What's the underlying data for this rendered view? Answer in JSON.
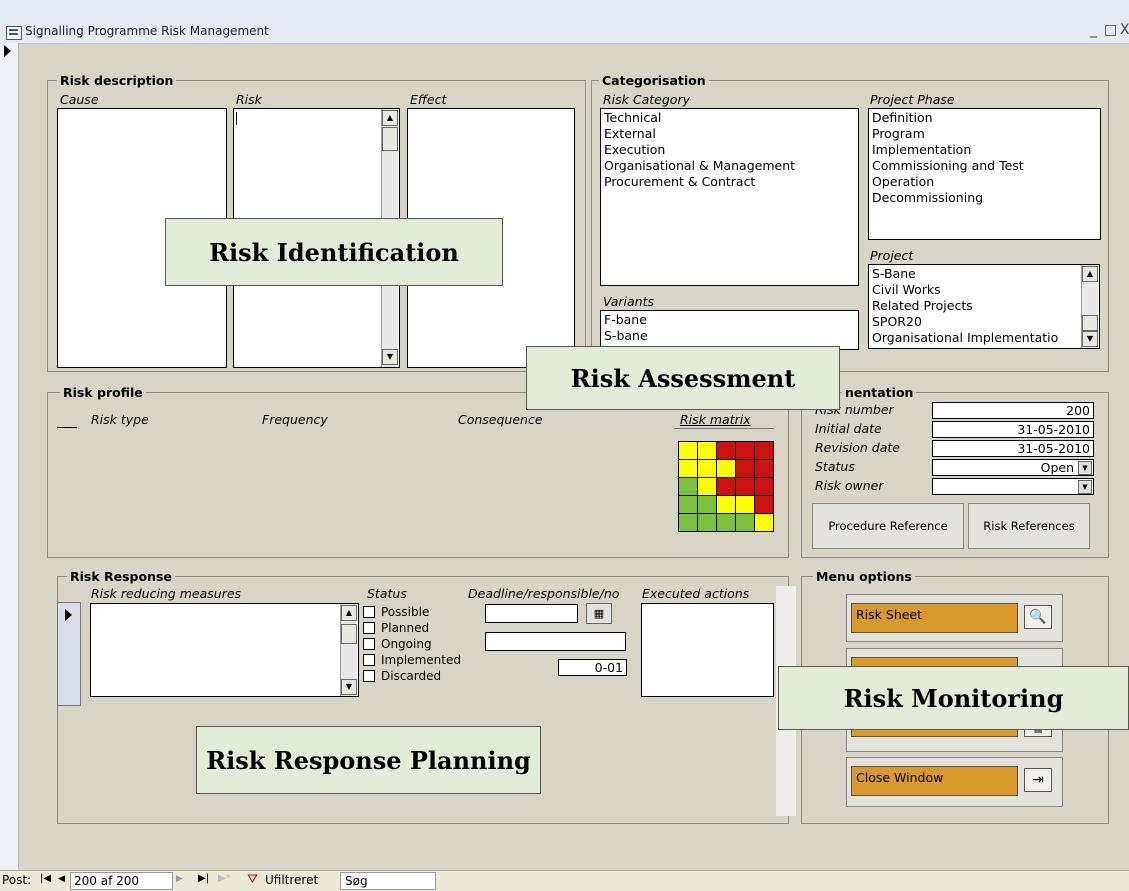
{
  "window": {
    "title": "Signalling Programme Risk Management",
    "minimize": "_",
    "maximize": "□",
    "close": "X",
    "icon": "form-icon"
  },
  "risk_description": {
    "legend": "Risk description",
    "cause_label": "Cause",
    "risk_label": "Risk",
    "effect_label": "Effect"
  },
  "categorisation": {
    "legend": "Categorisation",
    "risk_category_label": "Risk Category",
    "risk_categories": "Technical\nExternal\nExecution\nOrganisational & Management\nProcurement & Contract",
    "project_phase_label": "Project Phase",
    "project_phases": "Definition\nProgram\nImplementation\nCommissioning and Test\nOperation\nDecommissioning",
    "project_label": "Project",
    "projects": "S-Bane\nCivil Works\nRelated Projects\nSPOR20\nOrganisational Implementatio",
    "variants_label": "Variants",
    "variants": "F-bane\nS-bane"
  },
  "risk_profile": {
    "legend": "Risk profile",
    "risk_type_label": "Risk type",
    "frequency_label": "Frequency",
    "consequence_label": "Consequence",
    "risk_matrix_label": "Risk matrix",
    "matrix_colors": [
      [
        "#ffff00",
        "#ffff00",
        "#cc1111",
        "#cc1111",
        "#cc1111"
      ],
      [
        "#ffff00",
        "#ffff00",
        "#ffff00",
        "#cc1111",
        "#cc1111"
      ],
      [
        "#7cc242",
        "#ffff00",
        "#cc1111",
        "#cc1111",
        "#cc1111"
      ],
      [
        "#7cc242",
        "#7cc242",
        "#ffff00",
        "#ffff00",
        "#cc1111"
      ],
      [
        "#7cc242",
        "#7cc242",
        "#7cc242",
        "#7cc242",
        "#ffff00"
      ]
    ]
  },
  "documentation": {
    "legend": "nentation",
    "risk_number_label": "Risk number",
    "risk_number": "200",
    "initial_date_label": "Initial date",
    "initial_date": "31-05-2010",
    "revision_date_label": "Revision date",
    "revision_date": "31-05-2010",
    "status_label": "Status",
    "status": "Open",
    "risk_owner_label": "Risk owner",
    "risk_owner": "",
    "procedure_reference": "Procedure Reference",
    "risk_references": "Risk References"
  },
  "risk_response": {
    "legend": "Risk Response",
    "measures_label": "Risk reducing measures",
    "status_label": "Status",
    "deadline_label": "Deadline/responsible/no",
    "executed_label": "Executed actions",
    "statuses": [
      "Possible",
      "Planned",
      "Ongoing",
      "Implemented",
      "Discarded"
    ],
    "number_value": "0-01"
  },
  "menu_options": {
    "legend": "Menu options",
    "risk_sheet": "Risk Sheet",
    "close_window": "Close Window"
  },
  "callouts": {
    "identification": "Risk Identification",
    "assessment": "Risk Assessment",
    "monitoring": "Risk Monitoring",
    "response_planning": "Risk Response Planning"
  },
  "statusbar": {
    "post_label": "Post:",
    "record_position": "200 af 200",
    "filter_label": "Ufiltreret",
    "search_label": "Søg"
  }
}
